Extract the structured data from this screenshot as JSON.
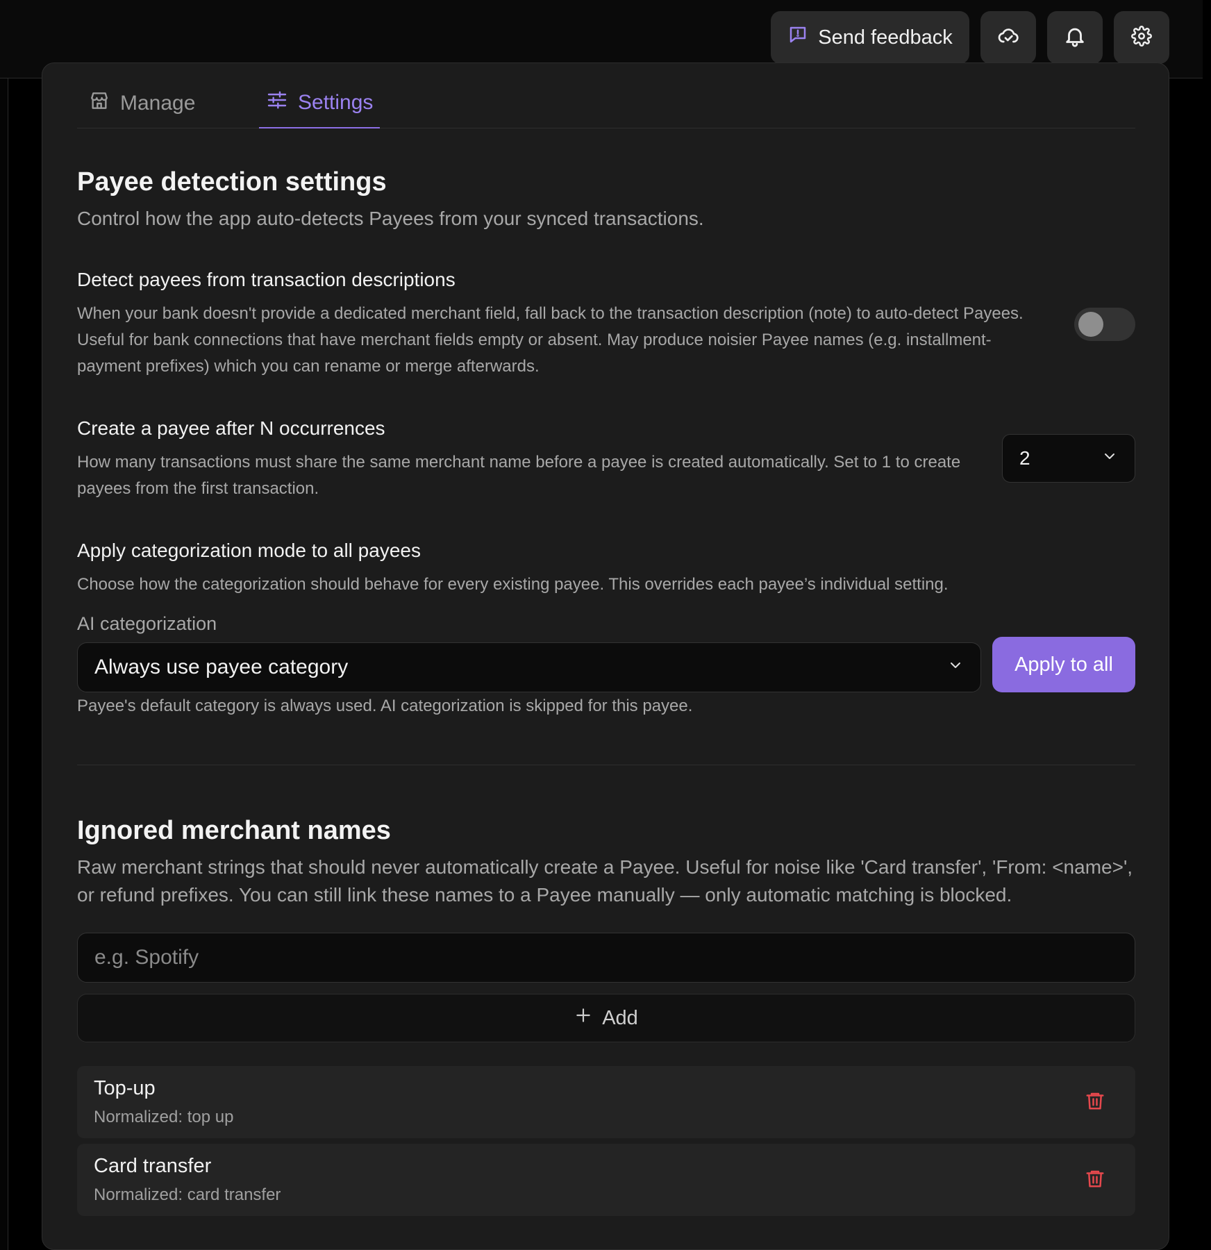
{
  "topbar": {
    "feedback_label": "Send feedback"
  },
  "tabs": [
    {
      "label": "Manage",
      "active": false
    },
    {
      "label": "Settings",
      "active": true
    }
  ],
  "payee_detection": {
    "title": "Payee detection settings",
    "subtitle": "Control how the app auto-detects Payees from your synced transactions.",
    "detect_from_description": {
      "title": "Detect payees from transaction descriptions",
      "description": "When your bank doesn't provide a dedicated merchant field, fall back to the transaction description (note) to auto-detect Payees. Useful for bank connections that have merchant fields empty or absent. May produce noisier Payee names (e.g. installment-payment prefixes) which you can rename or merge afterwards.",
      "enabled": false
    },
    "occurrences": {
      "title": "Create a payee after N occurrences",
      "description": "How many transactions must share the same merchant name before a payee is created automatically. Set to 1 to create payees from the first transaction.",
      "value": "2"
    },
    "categorization": {
      "title": "Apply categorization mode to all payees",
      "description": "Choose how the categorization should behave for every existing payee. This overrides each payee’s individual setting.",
      "field_label": "AI categorization",
      "selected": "Always use payee category",
      "apply_label": "Apply to all",
      "hint": "Payee's default category is always used. AI categorization is skipped for this payee."
    }
  },
  "ignored": {
    "title": "Ignored merchant names",
    "subtitle": "Raw merchant strings that should never automatically create a Payee. Useful for noise like 'Card transfer', 'From: <name>', or refund prefixes. You can still link these names to a Payee manually — only automatic matching is blocked.",
    "input_placeholder": "e.g. Spotify",
    "add_label": "Add",
    "items": [
      {
        "name": "Top-up",
        "normalized": "Normalized: top up"
      },
      {
        "name": "Card transfer",
        "normalized": "Normalized: card transfer"
      }
    ]
  },
  "colors": {
    "accent": "#8a6be0",
    "danger": "#e5484d",
    "background": "#1c1c1c"
  }
}
